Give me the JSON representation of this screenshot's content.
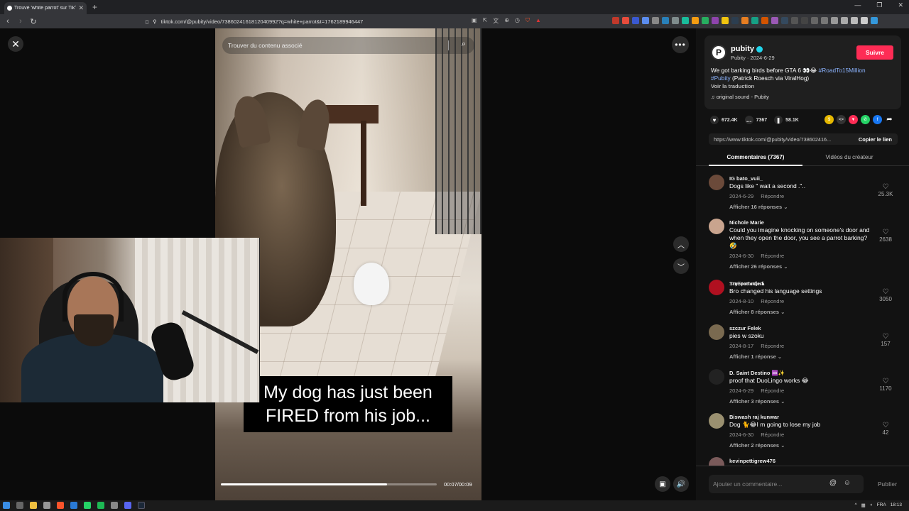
{
  "browser": {
    "tab_title": "Trouvé 'white parrot' sur TikT",
    "url": "tiktok.com/@pubity/video/7386024161812040992?q=white+parrot&t=1762189946447"
  },
  "video": {
    "search_placeholder": "Trouver du contenu associé",
    "caption_line1": "My dog has just been",
    "caption_line2": "FIRED from his job...",
    "time": "00:07/00:09",
    "progress": 0.77
  },
  "post": {
    "author": "pubity",
    "author_initial": "P",
    "sub": "Pubity · 2024-6-29",
    "follow_label": "Suivre",
    "description_text": "We got barking birds before GTA 6 👀😂 ",
    "tag1": "#RoadTo15Million",
    "tag2": "#Pubity",
    "credit": " (Patrick Roesch via ViralHog)",
    "translate": "Voir la traduction",
    "sound": "original sound - Pubity",
    "likes": "672.4K",
    "comments_count": "7367",
    "saves": "58.1K",
    "link": "https://www.tiktok.com/@pubity/video/738602416...",
    "copy_label": "Copier le lien"
  },
  "tabs": {
    "comments": "Commentaires (7367)",
    "creator_videos": "Vidéos du créateur"
  },
  "comments": [
    {
      "user": "IG bato_vuii_",
      "text": "Dogs like \" wait a second .\"..",
      "date": "2024-6-29",
      "reply": "Répondre",
      "more": "Afficher 16 réponses ⌄",
      "likes": "25.3K",
      "color": "#6b4a3a"
    },
    {
      "user": "Nichole Marie",
      "text": "Could you imagine knocking on someone's door and when they open the door, you see a parrot barking? 🤣",
      "date": "2024-6-30",
      "reply": "Répondre",
      "more": "Afficher 26 réponses ⌄",
      "likes": "2638",
      "color": "#c9a48e"
    },
    {
      "user": "𝕿𝖗𝖞𝕾𝖕𝖆𝖗𝖙𝖆𝖓𝖍𝖊𝖈𝖐",
      "text": "Bro changed his language settings",
      "date": "2024-8-10",
      "reply": "Répondre",
      "more": "Afficher 8 réponses ⌄",
      "likes": "3050",
      "color": "#b01020"
    },
    {
      "user": "szczur Felek",
      "text": "pies w szoku",
      "date": "2024-8-17",
      "reply": "Répondre",
      "more": "Afficher 1 réponse ⌄",
      "likes": "157",
      "color": "#7a6a50"
    },
    {
      "user": "D. Saint Destino ♾️✨",
      "text": "proof that DuoLingo works 😂",
      "date": "2024-6-29",
      "reply": "Répondre",
      "more": "Afficher 3 réponses ⌄",
      "likes": "1170",
      "color": "#222222"
    },
    {
      "user": "Biswash raj kunwar",
      "text": "Dog 🐈😂I m going to lose my job",
      "date": "2024-6-30",
      "reply": "Répondre",
      "more": "Afficher 2 réponses ⌄",
      "likes": "42",
      "color": "#9a9070"
    },
    {
      "user": "kevinpettigrew476",
      "text": "",
      "date": "",
      "reply": "",
      "more": "",
      "likes": "",
      "color": "#7a5a5a"
    }
  ],
  "composer": {
    "placeholder": "Ajouter un commentaire...",
    "post_label": "Publier"
  },
  "taskbar": {
    "lang": "FRA",
    "time": "18:13"
  }
}
